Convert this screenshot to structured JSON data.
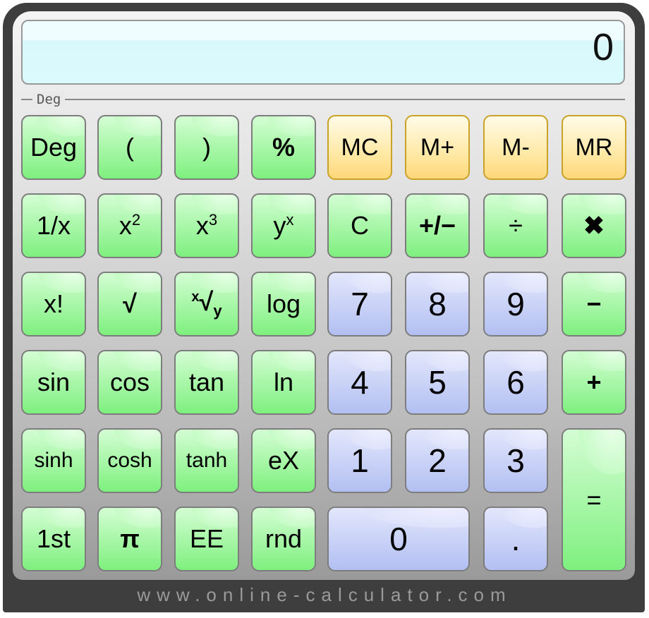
{
  "display": {
    "value": "0"
  },
  "mode": {
    "label": "Deg"
  },
  "footer": {
    "text": "www.online-calculator.com"
  },
  "colors": {
    "function_key": "#98f598",
    "digit_key": "#cdd5f8",
    "memory_key": "#ffe49a",
    "frame": "#3e3e3e"
  },
  "keys": [
    [
      {
        "label": "Deg",
        "name": "deg-button",
        "t": "g"
      },
      {
        "label": "(",
        "name": "open-paren-button",
        "t": "g"
      },
      {
        "label": ")",
        "name": "close-paren-button",
        "t": "g"
      },
      {
        "label": "%",
        "name": "percent-button",
        "t": "g"
      },
      {
        "label": "MC",
        "name": "memory-clear-button",
        "t": "y"
      },
      {
        "label": "M+",
        "name": "memory-add-button",
        "t": "y"
      },
      {
        "label": "M-",
        "name": "memory-subtract-button",
        "t": "y"
      },
      {
        "label": "MR",
        "name": "memory-recall-button",
        "t": "y"
      }
    ],
    [
      {
        "label": "1/x",
        "name": "reciprocal-button",
        "t": "g"
      },
      {
        "label": "x",
        "sup": "2",
        "name": "square-button",
        "t": "g"
      },
      {
        "label": "x",
        "sup": "3",
        "name": "cube-button",
        "t": "g"
      },
      {
        "label": "y",
        "sup": "x",
        "name": "power-button",
        "t": "g"
      },
      {
        "label": "C",
        "name": "clear-button",
        "t": "g"
      },
      {
        "label": "+/−",
        "name": "negate-button",
        "t": "g"
      },
      {
        "label": "÷",
        "name": "divide-button",
        "t": "g"
      },
      {
        "label": "✖",
        "name": "multiply-button",
        "t": "g"
      }
    ],
    [
      {
        "label": "x!",
        "name": "factorial-button",
        "t": "g"
      },
      {
        "label": "√",
        "name": "square-root-button",
        "t": "g"
      },
      {
        "label": "√",
        "pre": "x",
        "sub": "y",
        "name": "nth-root-button",
        "t": "g"
      },
      {
        "label": "log",
        "name": "log-button",
        "t": "g"
      },
      {
        "label": "7",
        "name": "digit-7-button",
        "t": "b"
      },
      {
        "label": "8",
        "name": "digit-8-button",
        "t": "b"
      },
      {
        "label": "9",
        "name": "digit-9-button",
        "t": "b"
      },
      {
        "label": "−",
        "name": "subtract-button",
        "t": "g"
      }
    ],
    [
      {
        "label": "sin",
        "name": "sin-button",
        "t": "g"
      },
      {
        "label": "cos",
        "name": "cos-button",
        "t": "g"
      },
      {
        "label": "tan",
        "name": "tan-button",
        "t": "g"
      },
      {
        "label": "ln",
        "name": "ln-button",
        "t": "g"
      },
      {
        "label": "4",
        "name": "digit-4-button",
        "t": "b"
      },
      {
        "label": "5",
        "name": "digit-5-button",
        "t": "b"
      },
      {
        "label": "6",
        "name": "digit-6-button",
        "t": "b"
      },
      {
        "label": "+",
        "name": "add-button",
        "t": "g"
      }
    ],
    [
      {
        "label": "sinh",
        "name": "sinh-button",
        "t": "g"
      },
      {
        "label": "cosh",
        "name": "cosh-button",
        "t": "g"
      },
      {
        "label": "tanh",
        "name": "tanh-button",
        "t": "g"
      },
      {
        "label": "eX",
        "name": "exp-button",
        "t": "g"
      },
      {
        "label": "1",
        "name": "digit-1-button",
        "t": "b"
      },
      {
        "label": "2",
        "name": "digit-2-button",
        "t": "b"
      },
      {
        "label": "3",
        "name": "digit-3-button",
        "t": "b"
      },
      {
        "label": "=",
        "name": "equals-button",
        "t": "g",
        "tall": true
      }
    ],
    [
      {
        "label": "1st",
        "name": "first-button",
        "t": "g"
      },
      {
        "label": "π",
        "name": "pi-button",
        "t": "g"
      },
      {
        "label": "EE",
        "name": "ee-button",
        "t": "g"
      },
      {
        "label": "rnd",
        "name": "random-button",
        "t": "g"
      },
      {
        "label": "0",
        "name": "digit-0-button",
        "t": "b",
        "wide": true
      },
      null,
      {
        "label": ".",
        "name": "decimal-button",
        "t": "b"
      },
      null
    ]
  ]
}
